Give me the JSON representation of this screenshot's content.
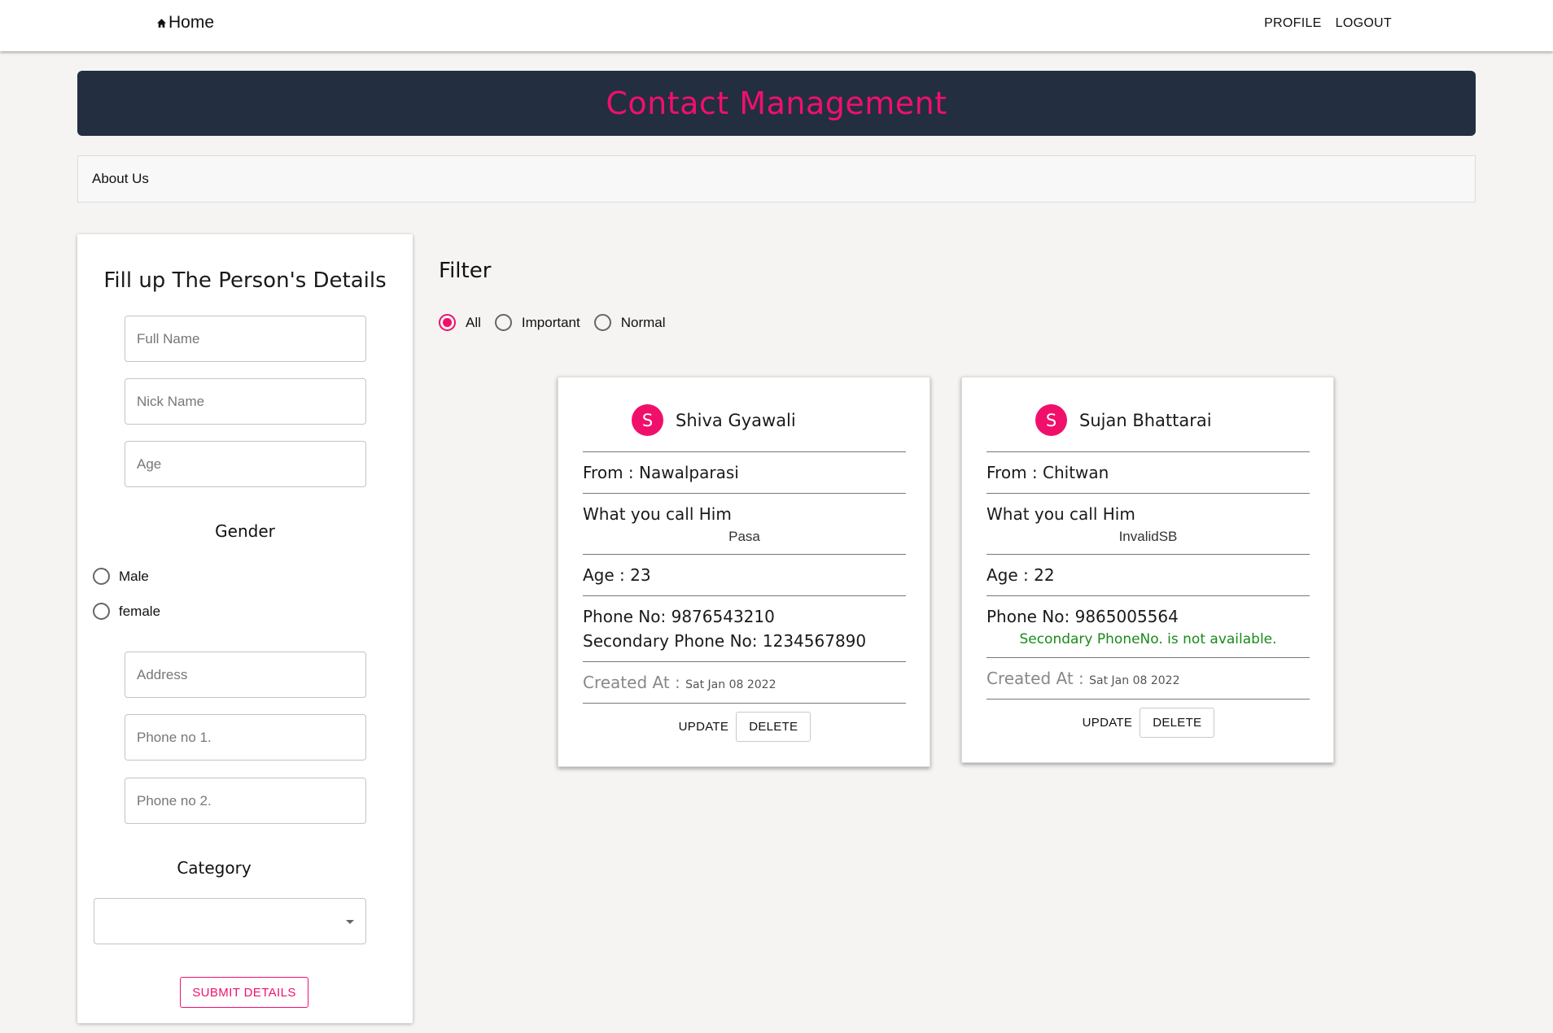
{
  "nav": {
    "home_label": "Home",
    "profile_label": "PROFILE",
    "logout_label": "LOGOUT"
  },
  "banner": {
    "title": "Contact Management"
  },
  "about": {
    "label": "About Us"
  },
  "form": {
    "title": "Fill up The Person's Details",
    "fullname_placeholder": "Full Name",
    "nickname_placeholder": "Nick Name",
    "age_placeholder": "Age",
    "gender_label": "Gender",
    "gender_options": [
      "Male",
      "female"
    ],
    "address_placeholder": "Address",
    "phone1_placeholder": "Phone no 1.",
    "phone2_placeholder": "Phone no 2.",
    "category_label": "Category",
    "category_value": "",
    "submit_label": "SUBMIT DETAILS"
  },
  "filter": {
    "title": "Filter",
    "options": [
      "All",
      "Important",
      "Normal"
    ],
    "selected": "All"
  },
  "accent_color": "#f0106b",
  "contacts": [
    {
      "initial": "S",
      "name": "Shiva Gyawali",
      "from": "From : Nawalparasi",
      "call_label": "What you call Him",
      "nickname": "Pasa",
      "age": "Age : 23",
      "phone": "Phone No: 9876543210",
      "secondary": "Secondary Phone No: 1234567890",
      "created_label": "Created At :",
      "created_date": "Sat Jan 08 2022",
      "update_label": "UPDATE",
      "delete_label": "DELETE"
    },
    {
      "initial": "S",
      "name": "Sujan Bhattarai",
      "from": "From : Chitwan",
      "call_label": "What you call Him",
      "nickname": "InvalidSB",
      "age": "Age : 22",
      "phone": "Phone No: 9865005564",
      "secondary_note": "Secondary PhoneNo. is not available.",
      "created_label": "Created At :",
      "created_date": "Sat Jan 08 2022",
      "update_label": "UPDATE",
      "delete_label": "DELETE"
    }
  ]
}
